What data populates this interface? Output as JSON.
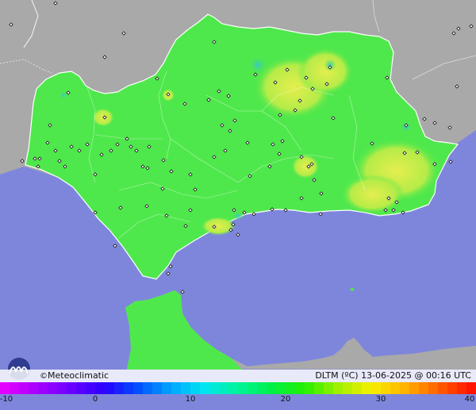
{
  "map": {
    "title": "",
    "brand": {
      "copyright_symbol": "©",
      "name": "Meteoclimatic"
    },
    "variable_label": "DLTM (ºC)",
    "timestamp": "13-06-2025 @ 00:16 UTC",
    "legend": {
      "min": -10,
      "max": 40,
      "tick_labels": [
        "-10",
        "0",
        "10",
        "20",
        "30",
        "40"
      ],
      "colors": [
        "#e400ff",
        "#a500ff",
        "#6a00ff",
        "#2a00ff",
        "#0050ff",
        "#00a6ff",
        "#00e6f0",
        "#00f49a",
        "#00f048",
        "#22f000",
        "#a0f000",
        "#f6f000",
        "#ffb400",
        "#ff6000",
        "#ff1400"
      ]
    },
    "colors": {
      "sea": "#7e86dc",
      "land_outside": "#a9a9a9",
      "region": "#4fe84c",
      "warm_patch": "#b6ec48",
      "cool_patch": "#3ed4a6"
    },
    "stations_shown": true
  }
}
